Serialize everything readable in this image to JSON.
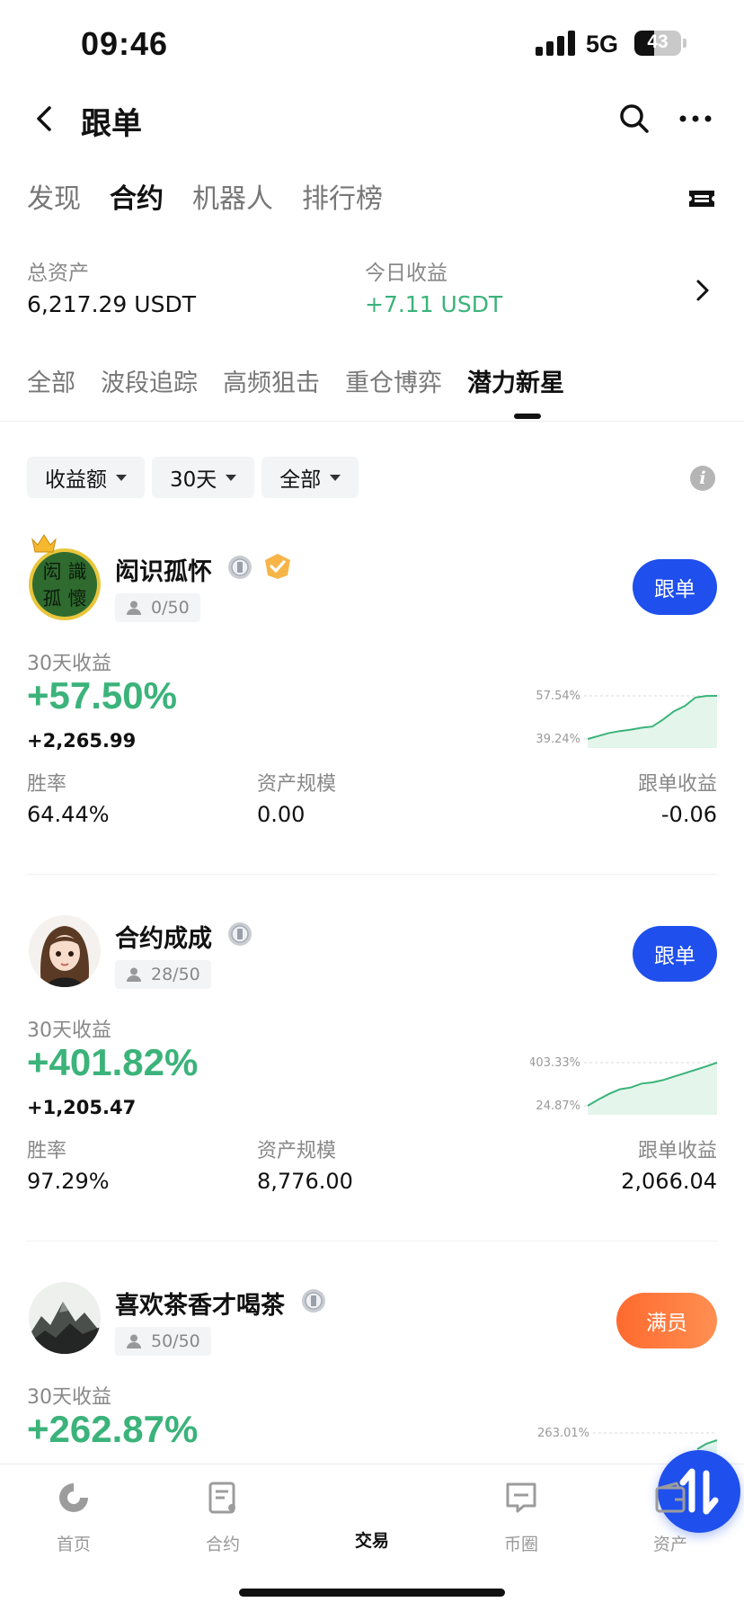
{
  "status": {
    "time": "09:46",
    "network": "5G",
    "battery": "43"
  },
  "header": {
    "title": "跟单"
  },
  "main_tabs": [
    {
      "label": "发现",
      "active": false
    },
    {
      "label": "合约",
      "active": true
    },
    {
      "label": "机器人",
      "active": false
    },
    {
      "label": "排行榜",
      "active": false
    }
  ],
  "summary": {
    "total_assets_label": "总资产",
    "total_assets_value": "6,217.29 USDT",
    "today_profit_label": "今日收益",
    "today_profit_value": "+7.11 USDT"
  },
  "category_tabs": [
    {
      "label": "全部",
      "active": false
    },
    {
      "label": "波段追踪",
      "active": false
    },
    {
      "label": "高频狙击",
      "active": false
    },
    {
      "label": "重仓博弈",
      "active": false
    },
    {
      "label": "潜力新星",
      "active": true
    }
  ],
  "filters": [
    {
      "label": "收益额"
    },
    {
      "label": "30天"
    },
    {
      "label": "全部"
    }
  ],
  "traders": [
    {
      "name": "闳识孤怀",
      "avatar_text": [
        "闳",
        "識",
        "孤",
        "懷"
      ],
      "copiers": "0/50",
      "follow_label": "跟单",
      "profit_label": "30天收益",
      "profit_pct": "+57.50%",
      "profit_amount": "+2,265.99",
      "spark_max": "57.54%",
      "spark_min": "39.24%",
      "spark_values": [
        39.24,
        40.5,
        41.8,
        42.6,
        43.2,
        44.0,
        44.5,
        47.5,
        51.0,
        53.2,
        56.8,
        57.5,
        57.54
      ],
      "win_rate_label": "胜率",
      "win_rate": "64.44%",
      "aum_label": "资产规模",
      "aum": "0.00",
      "copy_profit_label": "跟单收益",
      "copy_profit": "-0.06"
    },
    {
      "name": "合约成成",
      "copiers": "28/50",
      "follow_label": "跟单",
      "profit_label": "30天收益",
      "profit_pct": "+401.82%",
      "profit_amount": "+1,205.47",
      "spark_max": "403.33%",
      "spark_min": "24.87%",
      "spark_values": [
        24.87,
        80,
        130,
        170,
        185,
        220,
        230,
        250,
        280,
        310,
        340,
        370,
        403.33
      ],
      "win_rate_label": "胜率",
      "win_rate": "97.29%",
      "aum_label": "资产规模",
      "aum": "8,776.00",
      "copy_profit_label": "跟单收益",
      "copy_profit": "2,066.04"
    },
    {
      "name": "喜欢茶香才喝茶",
      "copiers": "50/50",
      "follow_label": "满员",
      "profit_label": "30天收益",
      "profit_pct": "+262.87%",
      "spark_max": "263.01%"
    }
  ],
  "bottom_nav": [
    {
      "label": "首页",
      "icon": "home-icon",
      "active": false
    },
    {
      "label": "合约",
      "icon": "contract-icon",
      "active": false
    },
    {
      "label": "交易",
      "icon": "trade-icon",
      "active": true
    },
    {
      "label": "币圈",
      "icon": "community-icon",
      "active": false
    },
    {
      "label": "资产",
      "icon": "wallet-icon",
      "active": false
    }
  ],
  "colors": {
    "accent": "#1f4fec",
    "positive": "#3bb37a",
    "full": "#ff7a3d"
  }
}
